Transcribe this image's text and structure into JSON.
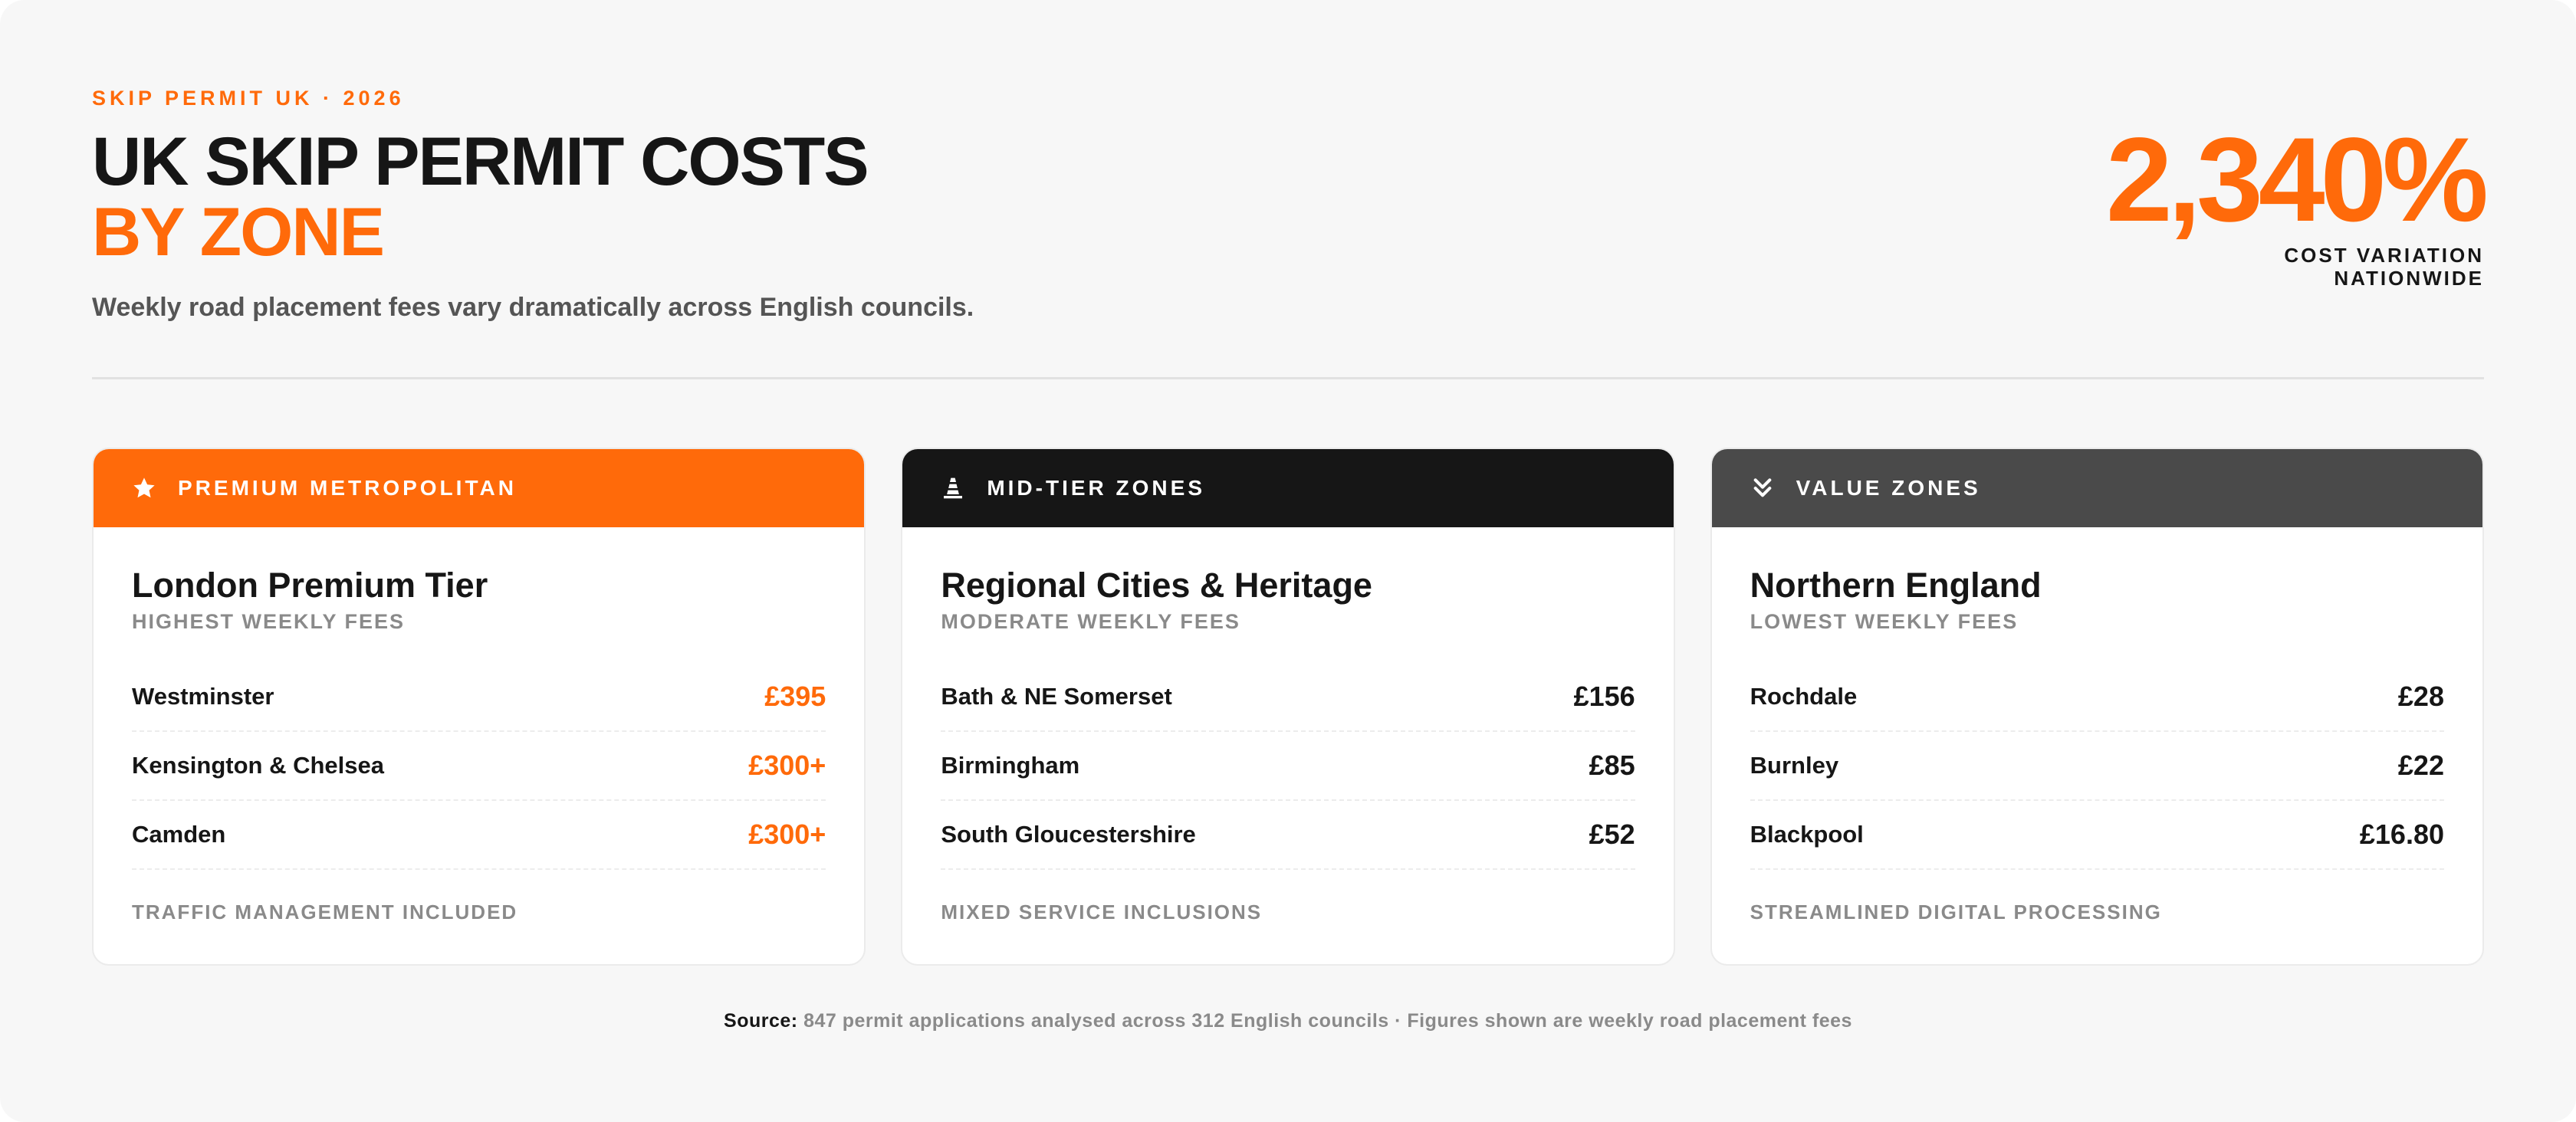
{
  "header": {
    "eyebrow": "SKIP PERMIT UK · 2026",
    "title_line1": "UK SKIP PERMIT COSTS",
    "title_line2": "BY ZONE",
    "subtitle": "Weekly road placement fees vary dramatically across English councils."
  },
  "stat": {
    "value": "2,340%",
    "label": "COST VARIATION NATIONWIDE"
  },
  "colors": {
    "accent": "#ff6a0a",
    "premium_header": "#ff6a0a",
    "midtier_header": "#161616",
    "value_header": "#4a4a4a"
  },
  "cards": [
    {
      "header_label": "PREMIUM METROPOLITAN",
      "icon": "star-icon",
      "title": "London Premium Tier",
      "subtitle": "HIGHEST WEEKLY FEES",
      "rows": [
        {
          "name": "Westminster",
          "fee": "£395"
        },
        {
          "name": "Kensington & Chelsea",
          "fee": "£300+"
        },
        {
          "name": "Camden",
          "fee": "£300+"
        }
      ],
      "footer": "TRAFFIC MANAGEMENT INCLUDED"
    },
    {
      "header_label": "MID-TIER ZONES",
      "icon": "traffic-cone-icon",
      "title": "Regional Cities & Heritage",
      "subtitle": "MODERATE WEEKLY FEES",
      "rows": [
        {
          "name": "Bath & NE Somerset",
          "fee": "£156"
        },
        {
          "name": "Birmingham",
          "fee": "£85"
        },
        {
          "name": "South Gloucestershire",
          "fee": "£52"
        }
      ],
      "footer": "MIXED SERVICE INCLUSIONS"
    },
    {
      "header_label": "VALUE ZONES",
      "icon": "double-chevron-down-icon",
      "title": "Northern England",
      "subtitle": "LOWEST WEEKLY FEES",
      "rows": [
        {
          "name": "Rochdale",
          "fee": "£28"
        },
        {
          "name": "Burnley",
          "fee": "£22"
        },
        {
          "name": "Blackpool",
          "fee": "£16.80"
        }
      ],
      "footer": "STREAMLINED DIGITAL PROCESSING"
    }
  ],
  "source": {
    "label": "Source:",
    "text": "847 permit applications analysed across 312 English councils · Figures shown are weekly road placement fees"
  }
}
